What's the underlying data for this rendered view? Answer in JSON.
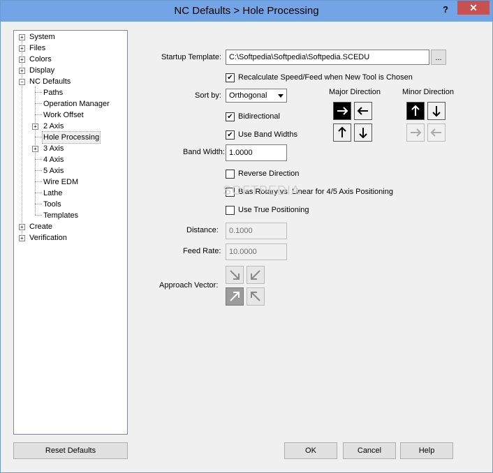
{
  "window": {
    "title": "NC Defaults > Hole Processing",
    "help_label": "?",
    "close_label": "✕"
  },
  "tree": {
    "items": [
      {
        "label": "System",
        "expander": "+"
      },
      {
        "label": "Files",
        "expander": "+"
      },
      {
        "label": "Colors",
        "expander": "+"
      },
      {
        "label": "Display",
        "expander": "+"
      },
      {
        "label": "NC Defaults",
        "expander": "−"
      },
      {
        "label": "Paths"
      },
      {
        "label": "Operation Manager"
      },
      {
        "label": "Work Offset"
      },
      {
        "label": "2 Axis",
        "expander": "+"
      },
      {
        "label": "Hole Processing",
        "selected": true
      },
      {
        "label": "3 Axis",
        "expander": "+"
      },
      {
        "label": "4 Axis"
      },
      {
        "label": "5 Axis"
      },
      {
        "label": "Wire EDM"
      },
      {
        "label": "Lathe"
      },
      {
        "label": "Tools"
      },
      {
        "label": "Templates"
      },
      {
        "label": "Create",
        "expander": "+"
      },
      {
        "label": "Verification",
        "expander": "+"
      }
    ]
  },
  "form": {
    "startup_template_label": "Startup Template:",
    "startup_template_value": "C:\\Softpedia\\Softpedia\\Softpedia.SCEDU",
    "browse_label": "...",
    "recalc_label": "Recalculate Speed/Feed when New Tool is Chosen",
    "recalc_checked": "✔",
    "sort_by_label": "Sort by:",
    "sort_by_value": "Orthogonal",
    "bidirectional_label": "Bidirectional",
    "bidirectional_checked": "✔",
    "band_widths_label": "Use Band Widths",
    "band_widths_checked": "✔",
    "band_width_label": "Band Width:",
    "band_width_value": "1.0000",
    "reverse_label": "Reverse Direction",
    "bias_label": "Bias Rotary vs. Linear for 4/5 Axis Positioning",
    "true_pos_label": "Use True Positioning",
    "distance_label": "Distance:",
    "distance_value": "0.1000",
    "feed_rate_label": "Feed Rate:",
    "feed_rate_value": "10.0000",
    "approach_label": "Approach Vector:",
    "major_direction_label": "Major Direction",
    "minor_direction_label": "Minor Direction",
    "arrows": {
      "right": "→",
      "left": "←",
      "up": "↑",
      "down": "↓",
      "down_right": "↘",
      "down_left": "↙",
      "up_right": "↗",
      "up_left": "↖"
    }
  },
  "watermark": "SOFTPEDIA",
  "buttons": {
    "reset": "Reset Defaults",
    "ok": "OK",
    "cancel": "Cancel",
    "help": "Help"
  },
  "colors": {
    "titlebar": "#73a5e6",
    "close": "#c75050"
  }
}
